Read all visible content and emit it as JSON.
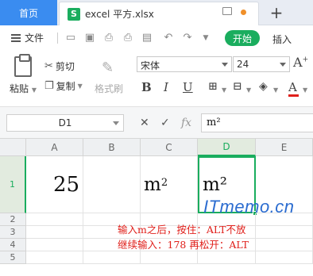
{
  "tabs": {
    "home": "首页",
    "file_name": "excel 平方.xlsx",
    "xls_badge": "S"
  },
  "menu": {
    "file_label": "文件",
    "start_label": "开始",
    "insert_label": "插入"
  },
  "toolbar": {
    "paste_label": "粘贴",
    "cut_label": "剪切",
    "copy_label": "复制",
    "format_painter_label": "格式刷",
    "font_name": "宋体",
    "font_size": "24",
    "font_color": "#e0201b"
  },
  "formula_bar": {
    "cell_ref": "D1",
    "content": "m²",
    "fx": "fx"
  },
  "columns": [
    "A",
    "B",
    "C",
    "D",
    "E"
  ],
  "rows": [
    "1",
    "2",
    "3",
    "4",
    "5"
  ],
  "cells": {
    "A1": "25",
    "C1_base": "m",
    "C1_sup": "2",
    "D1": "m²"
  },
  "annotations": {
    "line1": "输入m之后，按住：ALT不放",
    "line2": "继续输入：178 再松开：ALT",
    "watermark": "ITmemo.cn"
  },
  "colors": {
    "accent": "#1aad5e",
    "home_tab": "#3a8cf0",
    "annotation": "#e0201b",
    "watermark": "#2b6cd0"
  }
}
